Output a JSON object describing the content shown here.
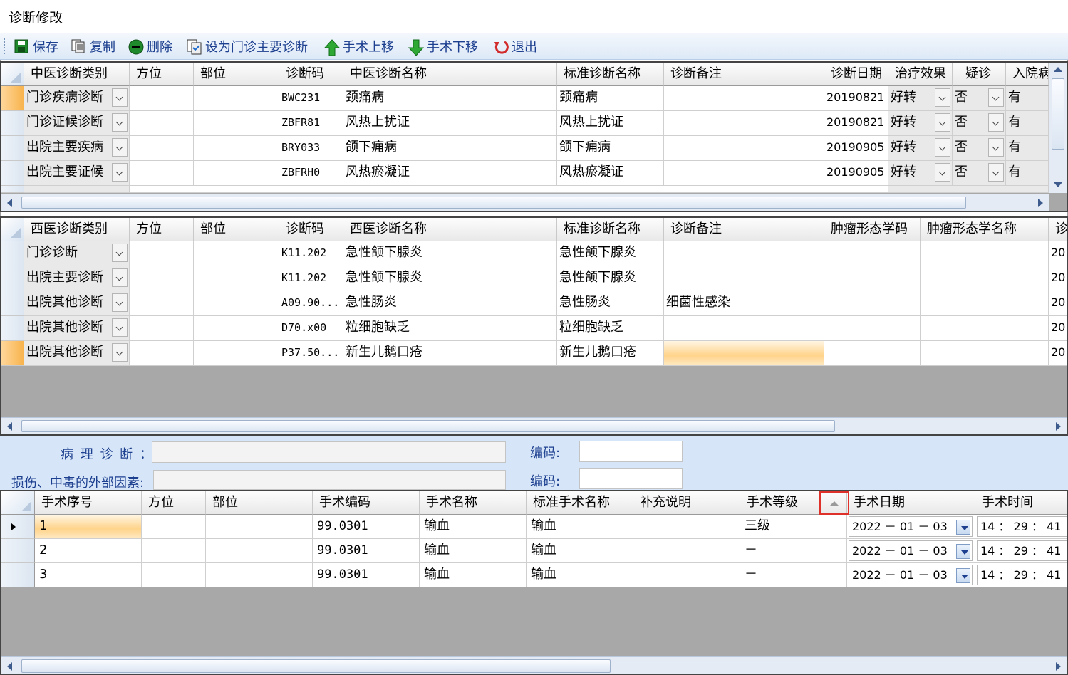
{
  "window": {
    "title": "诊断修改"
  },
  "toolbar": {
    "buttons": [
      {
        "label": "保存",
        "icon": "save-icon"
      },
      {
        "label": "复制",
        "icon": "copy-icon"
      },
      {
        "label": "删除",
        "icon": "delete-icon"
      },
      {
        "label": "设为门诊主要诊断",
        "icon": "set-primary-icon"
      },
      {
        "label": "手术上移",
        "icon": "arrow-up-icon"
      },
      {
        "label": "手术下移",
        "icon": "arrow-down-icon"
      },
      {
        "label": "退出",
        "icon": "exit-icon"
      }
    ]
  },
  "tcm_grid": {
    "headers": [
      "中医诊断类别",
      "方位",
      "部位",
      "诊断码",
      "中医诊断名称",
      "标准诊断名称",
      "诊断备注",
      "诊断日期",
      "治疗效果",
      "疑诊",
      "入院病"
    ],
    "rows": [
      {
        "type": "门诊疾病诊断",
        "pos": "",
        "part": "",
        "code": "BWC231",
        "name": "颈痛病",
        "std": "颈痛病",
        "note": "",
        "date": "20190821",
        "effect": "好转",
        "suspect": "否",
        "admit": "有"
      },
      {
        "type": "门诊证候诊断",
        "pos": "",
        "part": "",
        "code": "ZBFR81",
        "name": "风热上扰证",
        "std": "风热上扰证",
        "note": "",
        "date": "20190821",
        "effect": "好转",
        "suspect": "否",
        "admit": "有"
      },
      {
        "type": "出院主要疾病",
        "pos": "",
        "part": "",
        "code": "BRY033",
        "name": "颌下痈病",
        "std": "颌下痈病",
        "note": "",
        "date": "20190905",
        "effect": "好转",
        "suspect": "否",
        "admit": "有"
      },
      {
        "type": "出院主要证候",
        "pos": "",
        "part": "",
        "code": "ZBFRH0",
        "name": "风热瘀凝证",
        "std": "风热瘀凝证",
        "note": "",
        "date": "20190905",
        "effect": "好转",
        "suspect": "否",
        "admit": "有"
      }
    ]
  },
  "wm_grid": {
    "headers": [
      "西医诊断类别",
      "方位",
      "部位",
      "诊断码",
      "西医诊断名称",
      "标准诊断名称",
      "诊断备注",
      "肿瘤形态学码",
      "肿瘤形态学名称",
      "诊"
    ],
    "rows": [
      {
        "type": "门诊诊断",
        "code": "K11.202",
        "name": "急性颌下腺炎",
        "std": "急性颌下腺炎",
        "note": "",
        "date": "20"
      },
      {
        "type": "出院主要诊断",
        "code": "K11.202",
        "name": "急性颌下腺炎",
        "std": "急性颌下腺炎",
        "note": "",
        "date": "20"
      },
      {
        "type": "出院其他诊断",
        "code": "A09.90...",
        "name": "急性肠炎",
        "std": "急性肠炎",
        "note": "细菌性感染",
        "date": "20"
      },
      {
        "type": "出院其他诊断",
        "code": "D70.x00",
        "name": "粒细胞缺乏",
        "std": "粒细胞缺乏",
        "note": "",
        "date": "20"
      },
      {
        "type": "出院其他诊断",
        "code": "P37.50...",
        "name": "新生儿鹅口疮",
        "std": "新生儿鹅口疮",
        "note": "",
        "date": "20"
      }
    ]
  },
  "pathology": {
    "label": "病 理 诊 断 ：",
    "value": "",
    "code_label": "编码:",
    "code_value": "",
    "external_label": "损伤、中毒的外部因素:",
    "external_value": "",
    "external_code_label": "编码:",
    "external_code_value": ""
  },
  "surgery_grid": {
    "headers": [
      "手术序号",
      "方位",
      "部位",
      "手术编码",
      "手术名称",
      "标准手术名称",
      "补充说明",
      "手术等级",
      "手术日期",
      "手术时间"
    ],
    "rows": [
      {
        "seq": "1",
        "code": "99.0301",
        "name": "输血",
        "std": "输血",
        "note": "",
        "level": "三级",
        "date": "2022 － 01 － 03",
        "time": "14 ： 29 ： 41"
      },
      {
        "seq": "2",
        "code": "99.0301",
        "name": "输血",
        "std": "输血",
        "note": "",
        "level": "－",
        "date": "2022 － 01 － 03",
        "time": "14 ： 29 ： 41"
      },
      {
        "seq": "3",
        "code": "99.0301",
        "name": "输血",
        "std": "输血",
        "note": "",
        "level": "－",
        "date": "2022 － 01 － 03",
        "time": "14 ： 29 ： 41"
      }
    ]
  },
  "colors": {
    "accent": "#1d3f8f",
    "selection": "#f8b34d",
    "highlight_box": "#e0302a"
  }
}
